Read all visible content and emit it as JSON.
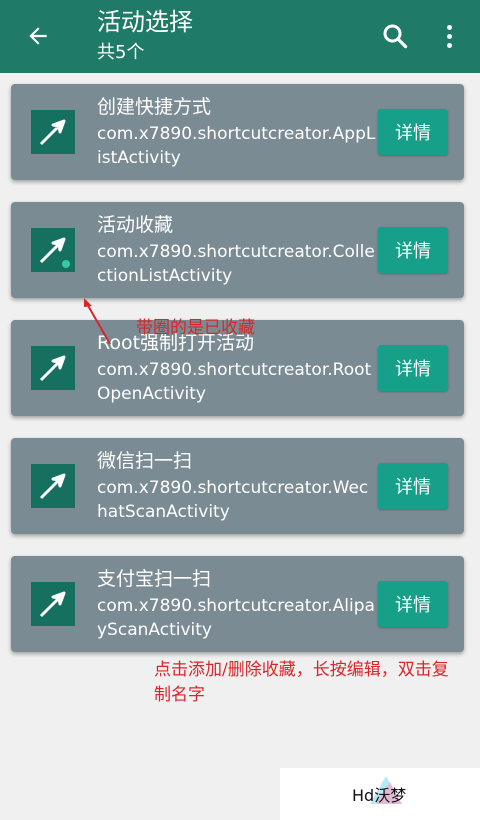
{
  "header": {
    "title": "活动选择",
    "subtitle": "共5个"
  },
  "colors": {
    "app_bar": "#1f7a68",
    "card": "#7a8b93",
    "button": "#16a08a",
    "annotation": "#d9262b"
  },
  "items": [
    {
      "name": "创建快捷方式",
      "package": "com.x7890.shortcutcreator.AppListActivity",
      "button": "详情",
      "favorite": false
    },
    {
      "name": "活动收藏",
      "package": "com.x7890.shortcutcreator.CollectionListActivity",
      "button": "详情",
      "favorite": true
    },
    {
      "name": "Root强制打开活动",
      "package": "com.x7890.shortcutcreator.RootOpenActivity",
      "button": "详情",
      "favorite": false
    },
    {
      "name": "微信扫一扫",
      "package": "com.x7890.shortcutcreator.WechatScanActivity",
      "button": "详情",
      "favorite": false
    },
    {
      "name": "支付宝扫一扫",
      "package": "com.x7890.shortcutcreator.AlipayScanActivity",
      "button": "详情",
      "favorite": false
    }
  ],
  "annotations": {
    "favorite_note": "带圈的是已收藏",
    "usage_note": "点击添加/删除收藏，长按编辑，双击复制名字"
  },
  "watermark": {
    "text": "Hd沃梦"
  }
}
